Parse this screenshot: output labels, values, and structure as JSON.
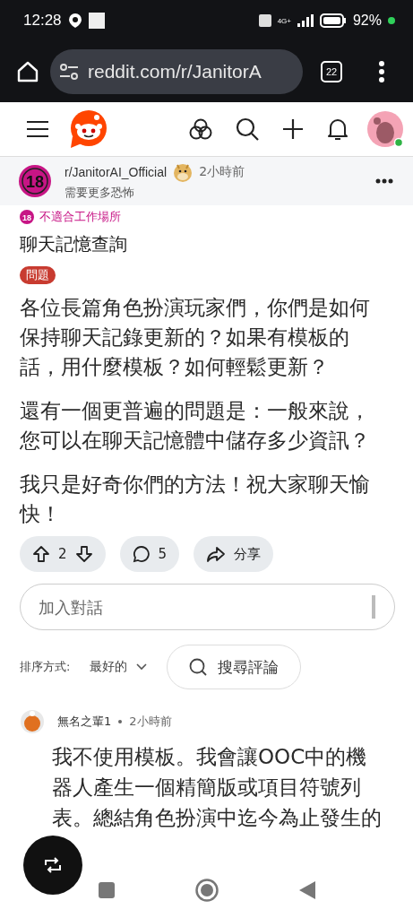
{
  "status_bar": {
    "time": "12:28",
    "network": "4G+",
    "battery": "92%"
  },
  "browser": {
    "url": "reddit.com/r/JanitorA",
    "tab_count": "22"
  },
  "post": {
    "community_badge": "18",
    "nsfw_badge": "18",
    "subreddit": "r/JanitorAI_Official",
    "time": "2小時前",
    "flair_user": "需要更多恐怖",
    "nsfw_label": "不適合工作場所",
    "title": "聊天記憶查詢",
    "tag": "問題",
    "paragraphs": [
      "各位長篇角色扮演玩家們，你們是如何保持聊天記錄更新的？如果有模板的話，用什麼模板？如何輕鬆更新？",
      "還有一個更普遍的問題是：一般來說，您可以在聊天記憶體中儲存多少資訊？",
      "我只是好奇你們的方法！祝大家聊天愉快！"
    ],
    "votes": "2",
    "comments": "5",
    "share": "分享"
  },
  "reply": {
    "placeholder": "加入對話"
  },
  "sort": {
    "label": "排序方式:",
    "value": "最好的",
    "search": "搜尋評論"
  },
  "comment": {
    "author": "無名之輩1",
    "time": "2小時前",
    "text": "我不使用模板。我會讓OOC中的機器人產生一個精簡版或項目符號列表。總結角色扮演中迄今為止發生的"
  }
}
